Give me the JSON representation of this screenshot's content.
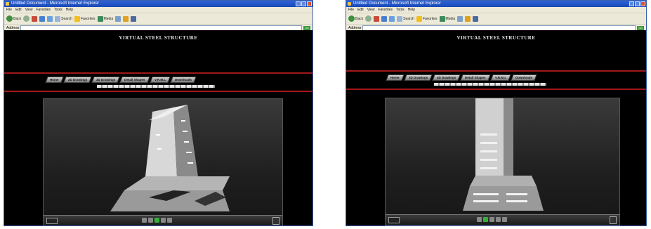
{
  "windows": [
    {
      "id": "left",
      "title": "Untitled Document - Microsoft Internet Explorer",
      "menu": [
        "File",
        "Edit",
        "View",
        "Favorites",
        "Tools",
        "Help"
      ],
      "toolbar": {
        "back": "Back",
        "search": "Search",
        "favorites": "Favorites",
        "media": "Media"
      },
      "address": {
        "label": "Address",
        "value": "",
        "go": "Go"
      },
      "site": {
        "title": "VIRTUAL STEEL STRUCTURE",
        "subtitle": "",
        "institution": ""
      },
      "nav_tabs": [
        "Home",
        "2D Drawings",
        "3D Drawings",
        "Detail Shapes",
        "V.R.M.L",
        "Downloads"
      ]
    },
    {
      "id": "right",
      "title": "Untitled Document - Microsoft Internet Explorer",
      "menu": [
        "File",
        "Edit",
        "View",
        "Favorites",
        "Tools",
        "Help"
      ],
      "toolbar": {
        "back": "Back",
        "search": "Search",
        "favorites": "Favorites",
        "media": "Media"
      },
      "address": {
        "label": "Address",
        "value": "",
        "go": "Go"
      },
      "site": {
        "title": "VIRTUAL STEEL STRUCTURE",
        "subtitle": "",
        "institution": ""
      },
      "nav_tabs": [
        "Home",
        "2D Drawings",
        "3D Drawings",
        "Detail Shapes",
        "V.R.M.L",
        "Downloads"
      ]
    }
  ],
  "colors": {
    "accent_red": "#a01818",
    "content_bg": "#000000",
    "titlebar": "#2c62d6",
    "play_active": "#36b03a"
  },
  "icons": [
    "back-icon",
    "forward-icon",
    "stop-icon",
    "refresh-icon",
    "home-icon",
    "search-icon",
    "favorites-icon",
    "media-icon",
    "history-icon",
    "mail-icon",
    "print-icon"
  ]
}
